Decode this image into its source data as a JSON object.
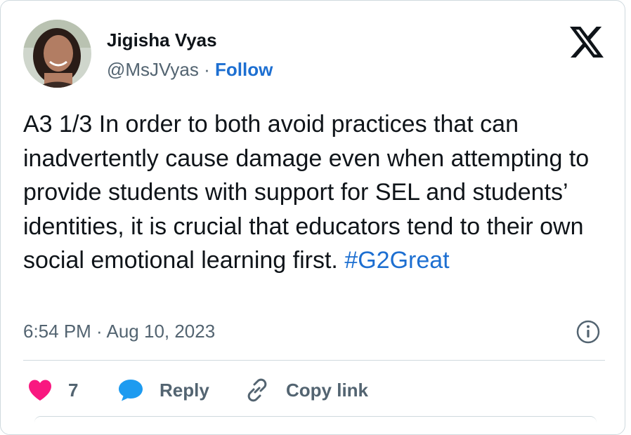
{
  "user": {
    "name": "Jigisha Vyas",
    "handle": "@MsJVyas",
    "separator": " · ",
    "follow_label": "Follow"
  },
  "tweet": {
    "text": "A3 1/3 In order to both avoid practices that can inadvertently cause damage even when attempting to provide students with support for SEL and students’ identities, it is crucial that educators tend to their own social emotional learning first. ",
    "hashtag": "#G2Great",
    "timestamp": "6:54 PM · Aug 10, 2023"
  },
  "actions": {
    "like_count": "7",
    "reply_label": "Reply",
    "copy_label": "Copy link"
  },
  "colors": {
    "link": "#1d6fd1",
    "like": "#f91880",
    "reply": "#1d9bf0",
    "muted": "#536471"
  },
  "icons": [
    "x-logo-icon",
    "info-icon",
    "heart-icon",
    "speech-bubble-icon",
    "link-icon"
  ]
}
